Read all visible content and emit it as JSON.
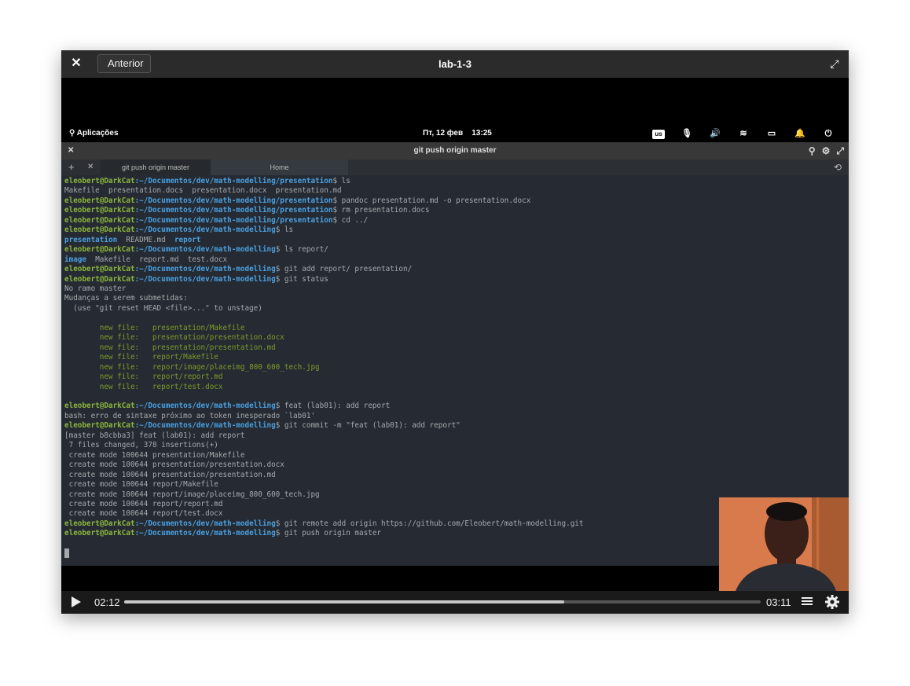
{
  "window": {
    "title": "lab-1-3",
    "back_label": "Anterior"
  },
  "panel": {
    "apps_label": "Aplicações",
    "date": "Пт, 12 фев",
    "time": "13:25",
    "keyboard_layout": "us"
  },
  "terminal": {
    "title": "git push origin master",
    "tabs": [
      {
        "label": "git push origin master"
      },
      {
        "label": "Home"
      }
    ],
    "user_host": "eleobert@DarkCat",
    "lines": [
      {
        "kind": "prompt",
        "path": ":~/Documentos/dev/math-modelling/presentation",
        "cmd": "$ ls"
      },
      {
        "kind": "out",
        "text": "Makefile  presentation.docs  presentation.docx  presentation.md"
      },
      {
        "kind": "prompt",
        "path": ":~/Documentos/dev/math-modelling/presentation",
        "cmd": "$ pandoc presentation.md -o presentation.docx"
      },
      {
        "kind": "prompt",
        "path": ":~/Documentos/dev/math-modelling/presentation",
        "cmd": "$ rm presentation.docs"
      },
      {
        "kind": "prompt",
        "path": ":~/Documentos/dev/math-modelling/presentation",
        "cmd": "$ cd ../"
      },
      {
        "kind": "prompt",
        "path": ":~/Documentos/dev/math-modelling",
        "cmd": "$ ls"
      },
      {
        "kind": "ls",
        "parts": [
          {
            "t": "presentation",
            "dir": true
          },
          {
            "t": "  README.md  ",
            "dir": false
          },
          {
            "t": "report",
            "dir": true
          }
        ]
      },
      {
        "kind": "prompt",
        "path": ":~/Documentos/dev/math-modelling",
        "cmd": "$ ls report/"
      },
      {
        "kind": "ls",
        "parts": [
          {
            "t": "image",
            "dir": true
          },
          {
            "t": "  Makefile  report.md  test.docx",
            "dir": false
          }
        ]
      },
      {
        "kind": "prompt",
        "path": ":~/Documentos/dev/math-modelling",
        "cmd": "$ git add report/ presentation/"
      },
      {
        "kind": "prompt",
        "path": ":~/Documentos/dev/math-modelling",
        "cmd": "$ git status"
      },
      {
        "kind": "out",
        "text": "No ramo master"
      },
      {
        "kind": "out",
        "text": "Mudanças a serem submetidas:"
      },
      {
        "kind": "out",
        "text": "  (use \"git reset HEAD <file>...\" to unstage)"
      },
      {
        "kind": "out",
        "text": ""
      },
      {
        "kind": "newfile",
        "text": "        new file:   presentation/Makefile"
      },
      {
        "kind": "newfile",
        "text": "        new file:   presentation/presentation.docx"
      },
      {
        "kind": "newfile",
        "text": "        new file:   presentation/presentation.md"
      },
      {
        "kind": "newfile",
        "text": "        new file:   report/Makefile"
      },
      {
        "kind": "newfile",
        "text": "        new file:   report/image/placeimg_800_600_tech.jpg"
      },
      {
        "kind": "newfile",
        "text": "        new file:   report/report.md"
      },
      {
        "kind": "newfile",
        "text": "        new file:   report/test.docx"
      },
      {
        "kind": "out",
        "text": ""
      },
      {
        "kind": "prompt",
        "path": ":~/Documentos/dev/math-modelling",
        "cmd": "$ feat (lab01): add report"
      },
      {
        "kind": "out",
        "text": "bash: erro de sintaxe próximo ao token inesperado `lab01'"
      },
      {
        "kind": "prompt",
        "path": ":~/Documentos/dev/math-modelling",
        "cmd": "$ git commit -m \"feat (lab01): add report\""
      },
      {
        "kind": "out",
        "text": "[master b8cbba3] feat (lab01): add report"
      },
      {
        "kind": "out",
        "text": " 7 files changed, 378 insertions(+)"
      },
      {
        "kind": "out",
        "text": " create mode 100644 presentation/Makefile"
      },
      {
        "kind": "out",
        "text": " create mode 100644 presentation/presentation.docx"
      },
      {
        "kind": "out",
        "text": " create mode 100644 presentation/presentation.md"
      },
      {
        "kind": "out",
        "text": " create mode 100644 report/Makefile"
      },
      {
        "kind": "out",
        "text": " create mode 100644 report/image/placeimg_800_600_tech.jpg"
      },
      {
        "kind": "out",
        "text": " create mode 100644 report/report.md"
      },
      {
        "kind": "out",
        "text": " create mode 100644 report/test.docx"
      },
      {
        "kind": "prompt",
        "path": ":~/Documentos/dev/math-modelling",
        "cmd": "$ git remote add origin https://github.com/Eleobert/math-modelling.git"
      },
      {
        "kind": "prompt",
        "path": ":~/Documentos/dev/math-modelling",
        "cmd": "$ git push origin master"
      },
      {
        "kind": "out",
        "text": ""
      }
    ]
  },
  "player": {
    "current_time": "02:12",
    "duration": "03:11",
    "progress": 0.691
  },
  "colors": {
    "prompt_user": "#8cb63b",
    "prompt_path": "#4aa0e0",
    "new_file": "#7d9a28",
    "terminal_bg": "#262b33"
  }
}
